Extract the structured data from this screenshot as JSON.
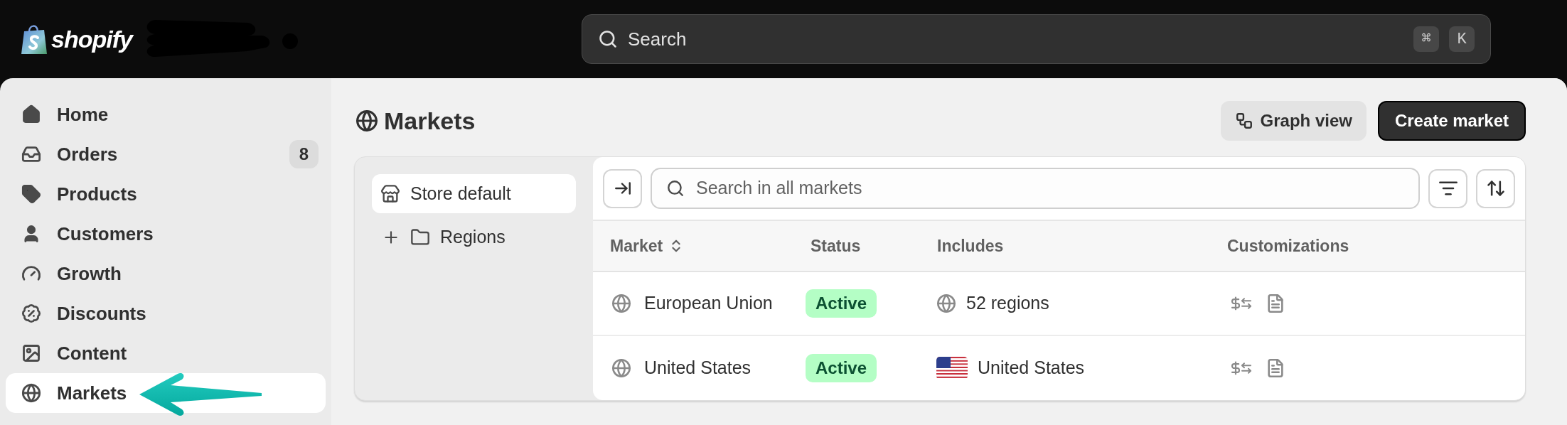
{
  "topbar": {
    "logo_text": "shopify",
    "search": {
      "placeholder": "Search",
      "shortcut": [
        "⌘",
        "K"
      ]
    }
  },
  "sidebar": {
    "items": [
      {
        "label": "Home",
        "selected": false
      },
      {
        "label": "Orders",
        "selected": false,
        "badge": "8"
      },
      {
        "label": "Products",
        "selected": false
      },
      {
        "label": "Customers",
        "selected": false
      },
      {
        "label": "Growth",
        "selected": false
      },
      {
        "label": "Discounts",
        "selected": false
      },
      {
        "label": "Content",
        "selected": false
      },
      {
        "label": "Markets",
        "selected": true
      }
    ]
  },
  "page": {
    "title": "Markets",
    "actions": [
      {
        "label": "Graph view",
        "kind": "secondary"
      },
      {
        "label": "Create market",
        "kind": "primary"
      }
    ]
  },
  "tree": {
    "items": [
      {
        "label": "Store default",
        "selected": true
      },
      {
        "label": "Regions",
        "selected": false,
        "expanded": false
      }
    ]
  },
  "table": {
    "search": {
      "placeholder": "Search in all markets"
    },
    "columns": [
      {
        "label": "Market",
        "sortable": true
      },
      {
        "label": "Status",
        "sortable": false
      },
      {
        "label": "Includes",
        "sortable": false
      },
      {
        "label": "Customizations",
        "sortable": false
      }
    ],
    "rows": [
      {
        "market": "European Union",
        "status": "Active",
        "includes": {
          "kind": "globe",
          "text": "52 regions"
        }
      },
      {
        "market": "United States",
        "status": "Active",
        "includes": {
          "kind": "us-flag",
          "text": "United States"
        }
      }
    ]
  }
}
